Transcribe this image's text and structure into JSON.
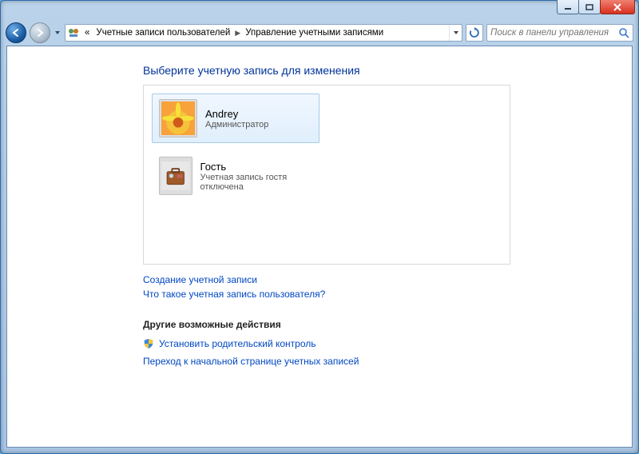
{
  "breadcrumb": {
    "prefix": "«",
    "item1": "Учетные записи пользователей",
    "item2": "Управление учетными записями"
  },
  "search": {
    "placeholder": "Поиск в панели управления"
  },
  "heading": "Выберите учетную запись для изменения",
  "accounts": {
    "andrey": {
      "name": "Andrey",
      "role": "Администратор"
    },
    "guest": {
      "name": "Гость",
      "role": "Учетная запись гостя отключена"
    }
  },
  "links": {
    "create": "Создание учетной записи",
    "whatis": "Что такое учетная запись пользователя?"
  },
  "other": {
    "title": "Другие возможные действия",
    "parental": "Установить родительский контроль",
    "goto": "Переход к начальной странице учетных записей"
  }
}
